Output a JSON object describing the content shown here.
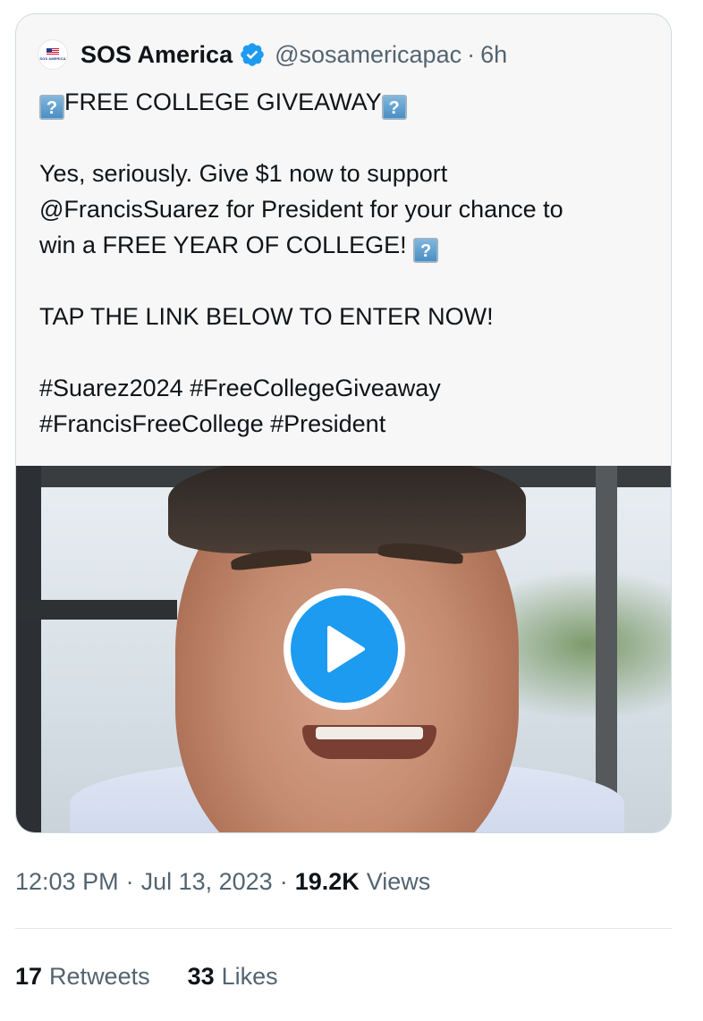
{
  "quoted_tweet": {
    "avatar_text": "SOS AMERICA",
    "display_name": "SOS America",
    "handle": "@sosamericapac",
    "separator": "·",
    "time_ago": "6h",
    "emoji_glyph": "?",
    "lines": {
      "headline": "FREE COLLEGE GIVEAWAY",
      "body_1": "Yes, seriously. Give $1 now to support",
      "body_2": "@FrancisSuarez for President for your chance to",
      "body_3": "win a FREE YEAR OF COLLEGE!",
      "cta": "TAP THE LINK BELOW TO ENTER NOW!",
      "hashtags_1": "#Suarez2024 #FreeCollegeGiveaway",
      "hashtags_2": "#FrancisFreeCollege #President"
    }
  },
  "meta": {
    "time": "12:03 PM",
    "date": "Jul 13, 2023",
    "separator": "·",
    "views_count": "19.2K",
    "views_label": "Views"
  },
  "stats": {
    "retweets_count": "17",
    "retweets_label": "Retweets",
    "likes_count": "33",
    "likes_label": "Likes"
  },
  "colors": {
    "accent": "#1d9bf0",
    "text_primary": "#0f1419",
    "text_secondary": "#536471",
    "card_background": "#f7f7f7",
    "border": "#cfd9de"
  },
  "icons": {
    "verified": "verified-badge-icon",
    "play": "play-icon",
    "emoji": "unsupported-emoji-icon"
  }
}
